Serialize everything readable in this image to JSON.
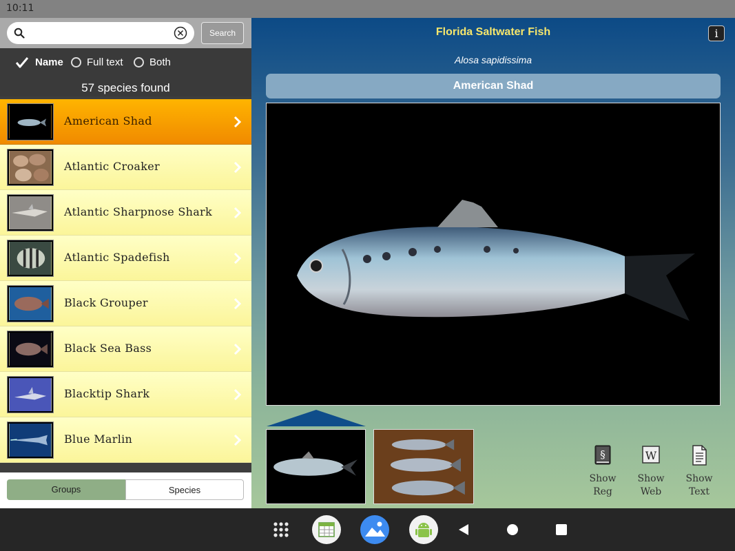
{
  "status": {
    "time": "10:11"
  },
  "search": {
    "placeholder": "",
    "value": "",
    "button_label": "Search"
  },
  "options": {
    "name": "Name",
    "full_text": "Full text",
    "both": "Both",
    "selected": "Name"
  },
  "species_count": "57 species found",
  "species": [
    {
      "label": "American Shad",
      "thumb": "shad",
      "selected": true
    },
    {
      "label": "Atlantic Croaker",
      "thumb": "croaker",
      "selected": false
    },
    {
      "label": "Atlantic Sharpnose Shark",
      "thumb": "sharpnose",
      "selected": false
    },
    {
      "label": "Atlantic Spadefish",
      "thumb": "spadefish",
      "selected": false
    },
    {
      "label": "Black Grouper",
      "thumb": "grouper",
      "selected": false
    },
    {
      "label": "Black Sea Bass",
      "thumb": "seabass",
      "selected": false
    },
    {
      "label": "Blacktip Shark",
      "thumb": "blacktip",
      "selected": false
    },
    {
      "label": "Blue Marlin",
      "thumb": "marlin",
      "selected": false
    }
  ],
  "segments": {
    "groups": "Groups",
    "species": "Species",
    "active": "Species"
  },
  "detail": {
    "app_title": "Florida Saltwater Fish",
    "info_label": "i",
    "scientific_name": "Alosa sapidissima",
    "common_name": "American Shad"
  },
  "actions": {
    "reg": {
      "line1": "Show",
      "line2": "Reg",
      "icon": "law-book-icon"
    },
    "web": {
      "line1": "Show",
      "line2": "Web",
      "icon": "wikipedia-icon"
    },
    "text": {
      "line1": "Show",
      "line2": "Text",
      "icon": "document-icon"
    }
  },
  "colors": {
    "title_yellow": "#f6e66c",
    "selected_row": "#ffb400",
    "row_yellow": "#fbf59a",
    "panel_blue": "#0c4a86"
  }
}
